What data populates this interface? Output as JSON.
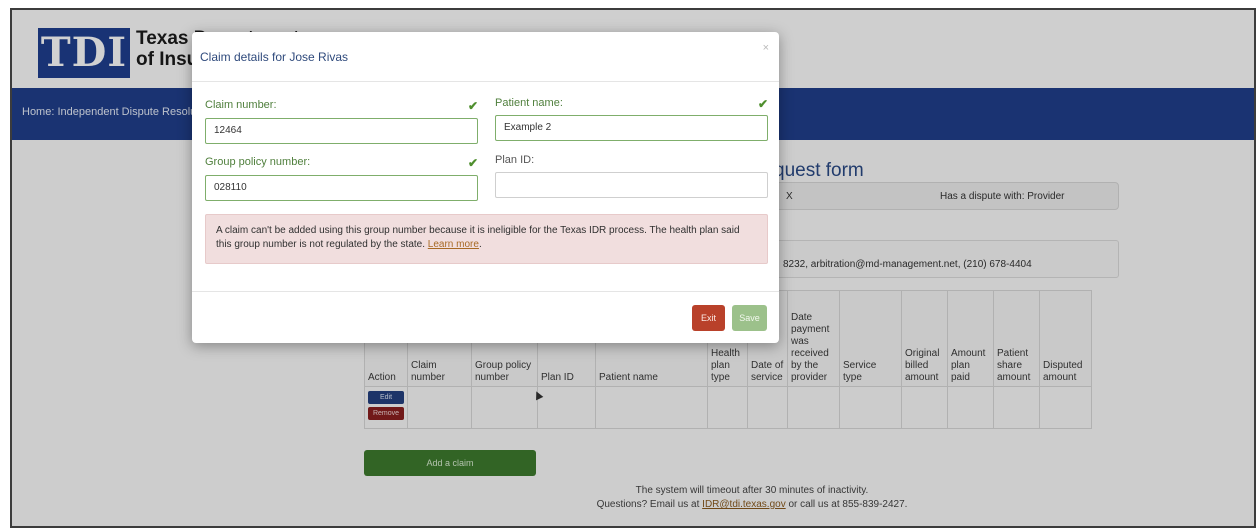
{
  "header": {
    "logo_text": "TDI",
    "org_line1": "Texas Department",
    "org_line2": "of Insurance"
  },
  "nav": {
    "breadcrumb": "Home: Independent Dispute Resolution"
  },
  "form": {
    "title_partial": "quest form",
    "summary_x": "X",
    "dispute_text": "Has a dispute with: Provider",
    "contact_partial": "8232, arbitration@md-management.net, (210) 678-4404"
  },
  "table": {
    "headers": [
      "Action",
      "Claim number",
      "Group policy number",
      "Plan ID",
      "Patient name",
      "Health plan type",
      "Date of service",
      "Date payment was received by the provider",
      "Service type",
      "Original billed amount",
      "Amount plan paid",
      "Patient share amount",
      "Disputed amount"
    ],
    "edit_label": "Edit",
    "remove_label": "Remove"
  },
  "add_claim_label": "Add a claim",
  "footer": {
    "timeout": "The system will timeout after 30 minutes of inactivity.",
    "questions_prefix": "Questions? Email us at",
    "email": "IDR@tdi.texas.gov",
    "questions_suffix": "or call us at 855-839-2427."
  },
  "modal": {
    "title": "Claim details for Jose Rivas",
    "close_glyph": "×",
    "claim_number_label": "Claim number:",
    "claim_number_value": "12464",
    "patient_name_label": "Patient name:",
    "patient_name_value": "Example 2",
    "group_policy_label": "Group policy number:",
    "group_policy_value": "028110",
    "plan_id_label": "Plan ID:",
    "plan_id_value": "",
    "alert_text": "A claim can't be added using this group number because it is ineligible for the Texas IDR process. The health plan said this group number is not regulated by the state.",
    "alert_link": "Learn more",
    "exit_label": "Exit",
    "save_label": "Save"
  },
  "colors": {
    "brand_blue": "#203f8c",
    "valid_green": "#4f8f2e",
    "exit_red": "#b9412a",
    "save_green": "#9cc18b",
    "alert_bg": "#f1dede"
  }
}
